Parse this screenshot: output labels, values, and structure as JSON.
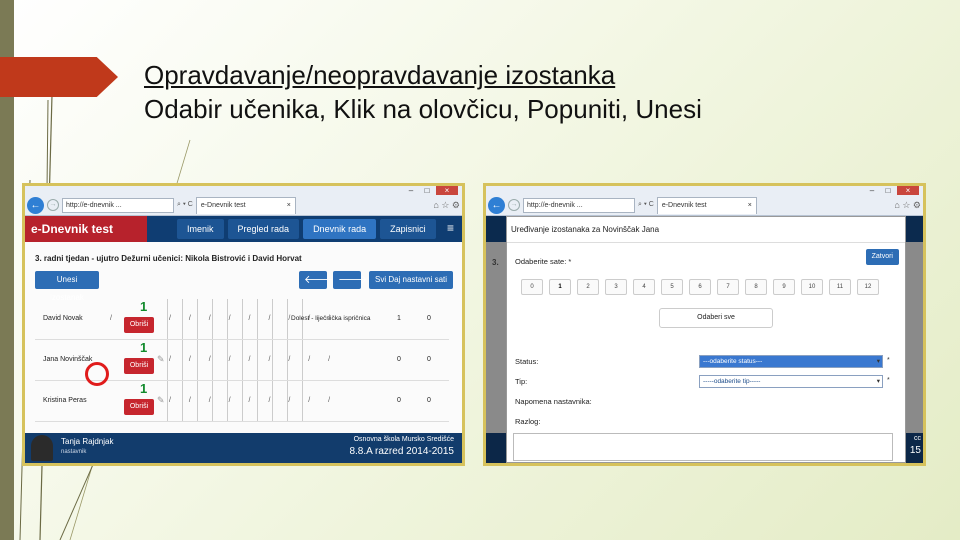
{
  "slide": {
    "title_line1": "Opravdavanje/neopravdavanje izostanka",
    "title_line2": "Odabir učenika, Klik na olovčicu, Popuniti, Unesi"
  },
  "browser": {
    "url": "http://e-dnevnik ...",
    "tab_title": "e-Dnevnik test",
    "tab_close": "×",
    "search_glyph": "⌕ ▾ C",
    "min": "–",
    "max": "□",
    "close": "×",
    "back": "←",
    "fwd": "→",
    "tools": "⌂ ☆ ⚙"
  },
  "app": {
    "logo": "e-Dnevnik test",
    "nav": [
      "Imenik",
      "Pregled rada",
      "Dnevnik rada",
      "Zapisnici"
    ],
    "active_nav": 2,
    "menu_glyph": "≡",
    "week_title": "3. radni tjedan - ujutro Dežurni učenici: Nikola Bistrović i David Horvat",
    "btn_unesi": "Unesi izostanak",
    "btn_prev": "🡐",
    "btn_next": "🡒",
    "btn_sati": "Svi Daj nastavni sati",
    "rows": [
      {
        "name": "David Novak",
        "count": "1",
        "delete": "Obriši",
        "reason": "Dolest - liječnička ispričnica",
        "c1": "1",
        "c2": "0"
      },
      {
        "name": "Jana Novinščak",
        "count": "1",
        "delete": "Obriši",
        "reason": "",
        "c1": "0",
        "c2": "0"
      },
      {
        "name": "Kristina Peras",
        "count": "1",
        "delete": "Obriši",
        "reason": "",
        "c1": "0",
        "c2": "0"
      }
    ],
    "tick_marks": "/ / / / / / / / /",
    "apostrophe": "/",
    "pencil": "✎",
    "footer_teacher": "Tanja Rajdnjak",
    "footer_role": "nastavnik",
    "footer_school": "Osnovna škola Mursko Središće",
    "footer_class": "8.8.A razred 2014-2015"
  },
  "modal": {
    "title": "Uređivanje izostanaka za Novinščak Jana",
    "close_button": "Zatvori",
    "periods_label": "Odaberite sate: *",
    "periods": [
      "0",
      "1",
      "2",
      "3",
      "4",
      "5",
      "6",
      "7",
      "8",
      "9",
      "10",
      "11",
      "12"
    ],
    "selected_period": "1",
    "select_all": "Odaberi sve",
    "status_label": "Status:",
    "status_value": "---odaberite status---",
    "tip_label": "Tip:",
    "tip_value": "-----odaberite tip-----",
    "note_label": "Napomena nastavnika:",
    "reason_label": "Razlog:",
    "required_mark": "*",
    "caret": "▾",
    "bg_week": "3.",
    "bg_year": "15",
    "bg_cc": "cc"
  }
}
